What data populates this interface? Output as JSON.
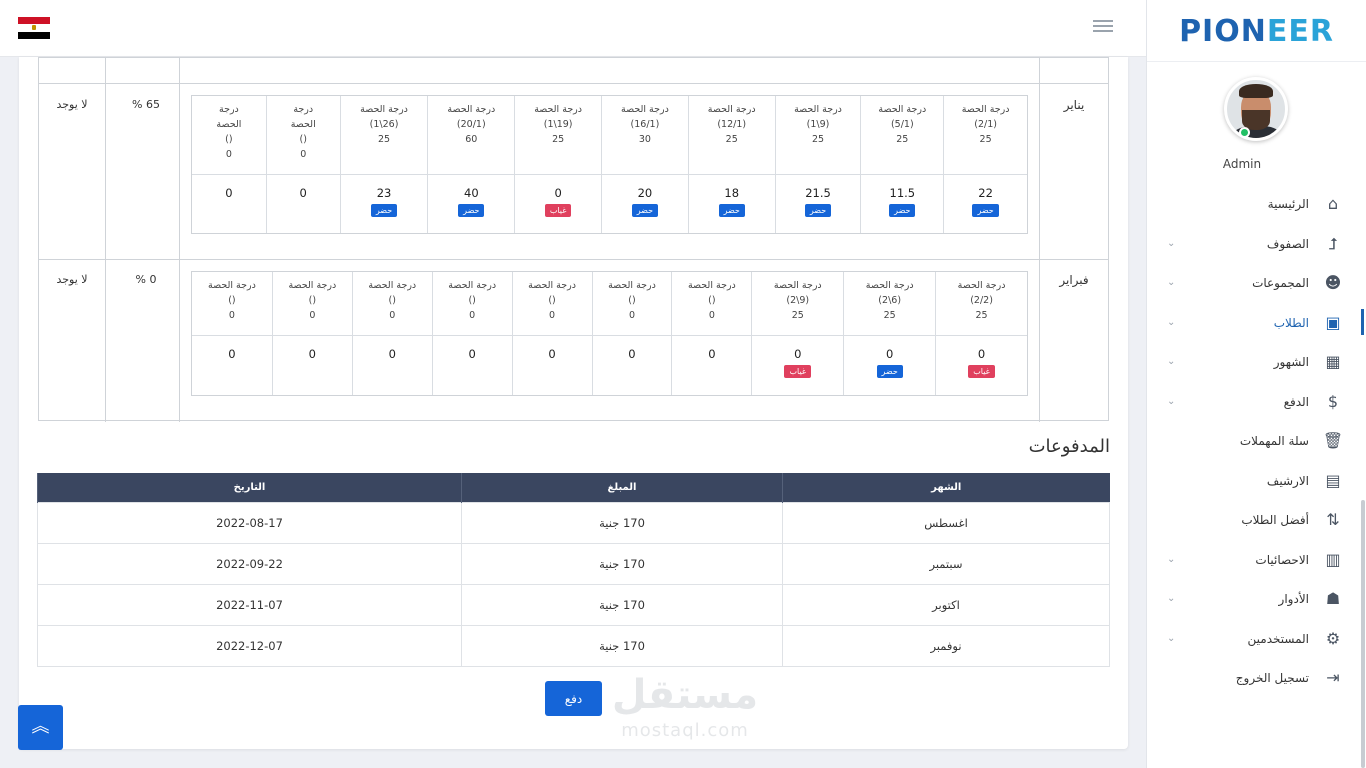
{
  "brand": {
    "part1": "PION",
    "part2": "EER"
  },
  "user": {
    "name": "Admin"
  },
  "nav": [
    {
      "label": "الرئيسية",
      "icon": "home-icon",
      "glyph": "⌂",
      "chevron": false
    },
    {
      "label": "الصفوف",
      "icon": "level-up-icon",
      "glyph": "⮥",
      "chevron": true
    },
    {
      "label": "المجموعات",
      "icon": "users-icon",
      "glyph": "☻",
      "chevron": true
    },
    {
      "label": "الطلاب",
      "icon": "school-icon",
      "glyph": "▣",
      "chevron": true,
      "active": true
    },
    {
      "label": "الشهور",
      "icon": "calendar-icon",
      "glyph": "▦",
      "chevron": true
    },
    {
      "label": "الدفع",
      "icon": "money-icon",
      "glyph": "$",
      "chevron": true
    },
    {
      "label": "سلة المهملات",
      "icon": "trash-icon",
      "glyph": "🗑",
      "chevron": false
    },
    {
      "label": "الارشيف",
      "icon": "archive-icon",
      "glyph": "▤",
      "chevron": false
    },
    {
      "label": "أفضل الطلاب",
      "icon": "sort-icon",
      "glyph": "⇅",
      "chevron": false
    },
    {
      "label": "الاحصائيات",
      "icon": "bar-chart-icon",
      "glyph": "▥",
      "chevron": true
    },
    {
      "label": "الأدوار",
      "icon": "user-shield-icon",
      "glyph": "☗",
      "chevron": true
    },
    {
      "label": "المستخدمين",
      "icon": "user-cog-icon",
      "glyph": "⚙",
      "chevron": true
    },
    {
      "label": "تسجيل الخروج",
      "icon": "sign-out-icon",
      "glyph": "⇥",
      "chevron": false
    }
  ],
  "months": [
    {
      "name": "يناير",
      "percent": "65 %",
      "note": "لا يوجد",
      "lessons": [
        {
          "title": "درجة الحصة",
          "date": "(2/1)",
          "max": "25",
          "score": "22",
          "status": "حضر",
          "type": "p"
        },
        {
          "title": "درجة الحصة",
          "date": "(5/1)",
          "max": "25",
          "score": "11.5",
          "status": "حضر",
          "type": "p"
        },
        {
          "title": "درجة الحصة",
          "date": "(9\\1)",
          "max": "25",
          "score": "21.5",
          "status": "حضر",
          "type": "p"
        },
        {
          "title": "درجة الحصة",
          "date": "(12/1)",
          "max": "25",
          "score": "18",
          "status": "حضر",
          "type": "p"
        },
        {
          "title": "درجة الحصة",
          "date": "(16/1)",
          "max": "30",
          "score": "20",
          "status": "حضر",
          "type": "p"
        },
        {
          "title": "درجة الحصة",
          "date": "(19\\1)",
          "max": "25",
          "score": "0",
          "status": "غياب",
          "type": "a"
        },
        {
          "title": "درجة الحصة",
          "date": "(20/1)",
          "max": "60",
          "score": "40",
          "status": "حضر",
          "type": "p"
        },
        {
          "title": "درجة الحصة",
          "date": "(26\\1)",
          "max": "25",
          "score": "23",
          "status": "حضر",
          "type": "p"
        },
        {
          "title": "درجة الحصة",
          "date": "()",
          "max": "0",
          "score": "0",
          "status": "",
          "type": ""
        },
        {
          "title": "درجة الحصة",
          "date": "()",
          "max": "0",
          "score": "0",
          "status": "",
          "type": ""
        }
      ]
    },
    {
      "name": "فبراير",
      "percent": "0 %",
      "note": "لا يوجد",
      "lessons": [
        {
          "title": "درجة الحصة",
          "date": "(2/2)",
          "max": "25",
          "score": "0",
          "status": "غياب",
          "type": "a"
        },
        {
          "title": "درجة الحصة",
          "date": "(6\\2)",
          "max": "25",
          "score": "0",
          "status": "حضر",
          "type": "p"
        },
        {
          "title": "درجة الحصة",
          "date": "(9\\2)",
          "max": "25",
          "score": "0",
          "status": "غياب",
          "type": "a"
        },
        {
          "title": "درجة الحصة",
          "date": "()",
          "max": "0",
          "score": "0",
          "status": "",
          "type": ""
        },
        {
          "title": "درجة الحصة",
          "date": "()",
          "max": "0",
          "score": "0",
          "status": "",
          "type": ""
        },
        {
          "title": "درجة الحصة",
          "date": "()",
          "max": "0",
          "score": "0",
          "status": "",
          "type": ""
        },
        {
          "title": "درجة الحصة",
          "date": "()",
          "max": "0",
          "score": "0",
          "status": "",
          "type": ""
        },
        {
          "title": "درجة الحصة",
          "date": "()",
          "max": "0",
          "score": "0",
          "status": "",
          "type": ""
        },
        {
          "title": "درجة الحصة",
          "date": "()",
          "max": "0",
          "score": "0",
          "status": "",
          "type": ""
        },
        {
          "title": "درجة الحصة",
          "date": "()",
          "max": "0",
          "score": "0",
          "status": "",
          "type": ""
        }
      ]
    }
  ],
  "payments": {
    "title": "المدفوعات",
    "headers": {
      "month": "الشهر",
      "amount": "المبلغ",
      "date": "التاريخ"
    },
    "rows": [
      {
        "month": "اغسطس",
        "amount": "170 جنية",
        "date": "2022-08-17"
      },
      {
        "month": "سبتمبر",
        "amount": "170 جنية",
        "date": "2022-09-22"
      },
      {
        "month": "اكتوبر",
        "amount": "170 جنية",
        "date": "2022-11-07"
      },
      {
        "month": "نوفمبر",
        "amount": "170 جنية",
        "date": "2022-12-07"
      }
    ],
    "button": "دفع"
  },
  "watermark": {
    "arabic": "مستقل",
    "latin": "mostaql.com"
  },
  "colors": {
    "primary": "#1565d8",
    "absent": "#e0405e",
    "table_header": "#3a4660"
  }
}
